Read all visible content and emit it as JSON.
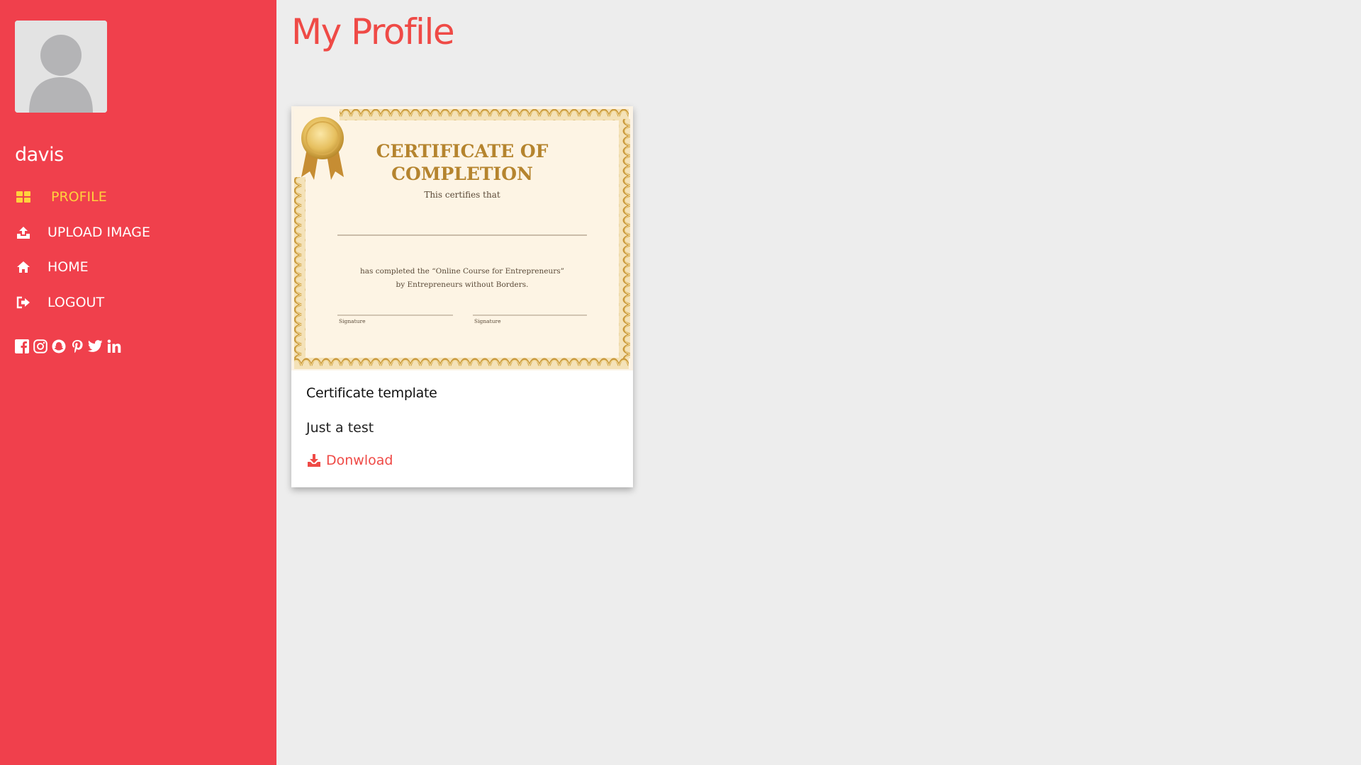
{
  "page": {
    "title": "My Profile"
  },
  "sidebar": {
    "username": "davis",
    "nav": [
      {
        "label": "PROFILE",
        "icon": "dashboard-icon",
        "active": true
      },
      {
        "label": "UPLOAD IMAGE",
        "icon": "upload-icon",
        "active": false
      },
      {
        "label": "HOME",
        "icon": "home-icon",
        "active": false
      },
      {
        "label": "LOGOUT",
        "icon": "logout-icon",
        "active": false
      }
    ],
    "social": [
      "facebook-icon",
      "instagram-icon",
      "snapchat-icon",
      "pinterest-icon",
      "twitter-icon",
      "linkedin-icon"
    ]
  },
  "card": {
    "title": "Certificate template",
    "description": "Just a test",
    "download_label": "Donwload",
    "certificate": {
      "heading_line1": "CERTIFICATE OF",
      "heading_line2": "COMPLETION",
      "certifies": "This certifies that",
      "completed_line1": "has completed the “Online Course for Entrepreneurs”",
      "completed_line2": "by Entrepreneurs without Borders.",
      "signature_left": "Signature",
      "signature_right": "Signature"
    }
  },
  "colors": {
    "sidebar_bg": "#f0404c",
    "accent": "#ef4a46",
    "active_nav": "#ffd23d",
    "page_bg": "#ededed"
  }
}
